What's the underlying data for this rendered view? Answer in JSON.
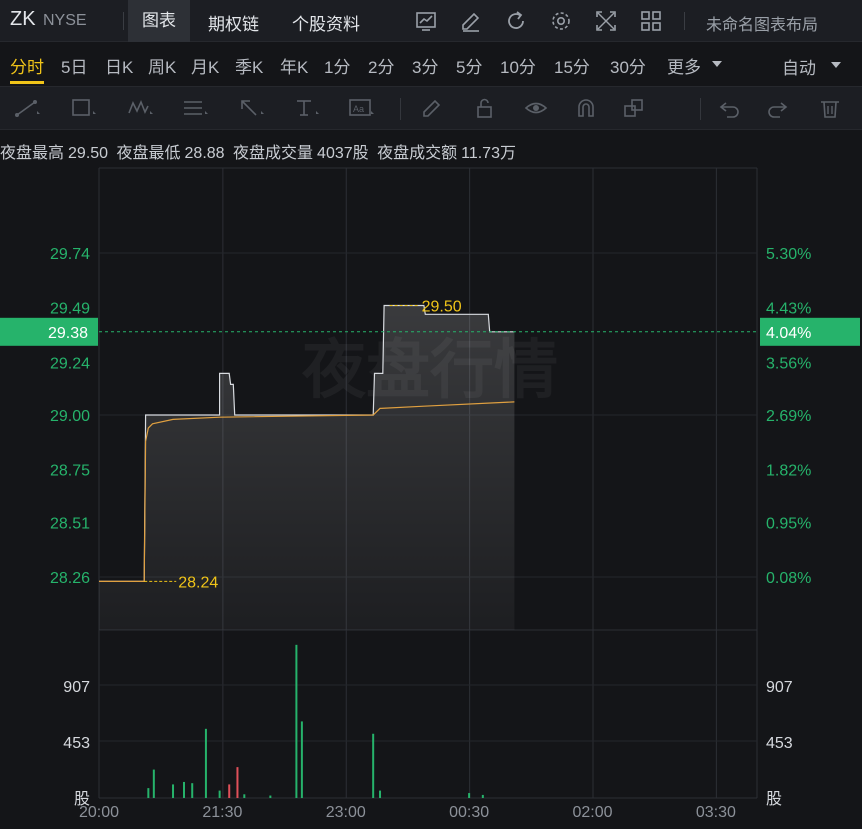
{
  "header": {
    "symbol": "ZK",
    "exchange": "NYSE",
    "tabs": [
      "图表",
      "期权链",
      "个股资料"
    ],
    "layout_label": "未命名图表布局",
    "icons": [
      "trend-chart-icon",
      "edit-icon",
      "refresh-icon",
      "settings-icon",
      "fullscreen-icon",
      "grid-layout-icon"
    ]
  },
  "periods": {
    "items": [
      "分时",
      "5日",
      "日K",
      "周K",
      "月K",
      "季K",
      "年K",
      "1分",
      "2分",
      "3分",
      "5分",
      "10分",
      "15分",
      "30分",
      "更多"
    ],
    "active": "分时",
    "auto_label": "自动"
  },
  "stats": {
    "high_label": "夜盘最高",
    "high_value": "29.50",
    "low_label": "夜盘最低",
    "low_value": "28.88",
    "volume_label": "夜盘成交量",
    "volume_value": "4037股",
    "turnover_label": "夜盘成交额",
    "turnover_value": "11.73万"
  },
  "colors": {
    "up": "#26b36b",
    "accent": "#f0c419",
    "down": "#e0505a",
    "avg_line": "#e0a040",
    "price_line": "#d8dbe0"
  },
  "chart_data": {
    "type": "line",
    "watermark": "夜盘行情",
    "current_price": "29.38",
    "current_pct": "4.04%",
    "high_marker": "29.50",
    "low_marker": "28.24",
    "y_ticks": [
      "29.74",
      "29.49",
      "29.24",
      "29.00",
      "28.75",
      "28.51",
      "28.26"
    ],
    "y_tick_values": [
      29.74,
      29.49,
      29.24,
      29.0,
      28.75,
      28.51,
      28.26
    ],
    "pct_ticks": [
      "5.30%",
      "4.43%",
      "3.56%",
      "2.69%",
      "1.82%",
      "0.95%",
      "0.08%"
    ],
    "x_ticks": [
      "20:00",
      "21:30",
      "23:00",
      "00:30",
      "02:00",
      "03:30"
    ],
    "x_tick_minutes": [
      0,
      90,
      180,
      270,
      360,
      450
    ],
    "x_range_minutes": [
      0,
      480
    ],
    "price_series": [
      [
        0,
        28.24
      ],
      [
        33,
        28.24
      ],
      [
        34,
        29.0
      ],
      [
        54,
        29.0
      ],
      [
        88,
        29.0
      ],
      [
        88,
        29.19
      ],
      [
        95,
        29.19
      ],
      [
        96,
        29.14
      ],
      [
        98,
        29.14
      ],
      [
        99,
        29.0
      ],
      [
        200,
        29.0
      ],
      [
        201,
        29.19
      ],
      [
        207,
        29.19
      ],
      [
        208,
        29.5
      ],
      [
        237,
        29.5
      ],
      [
        238,
        29.46
      ],
      [
        284,
        29.46
      ],
      [
        285,
        29.38
      ],
      [
        303,
        29.38
      ]
    ],
    "avg_series": [
      [
        0,
        28.24
      ],
      [
        33,
        28.24
      ],
      [
        34,
        28.88
      ],
      [
        36,
        28.94
      ],
      [
        39,
        28.96
      ],
      [
        54,
        28.98
      ],
      [
        88,
        28.99
      ],
      [
        200,
        29.0
      ],
      [
        205,
        29.03
      ],
      [
        237,
        29.04
      ],
      [
        303,
        29.06
      ]
    ],
    "volume_ticks": [
      "907",
      "453",
      "股"
    ],
    "volume_tick_values": [
      907,
      453,
      0
    ],
    "volume_bars": [
      {
        "t": 36,
        "v": 80,
        "c": "up"
      },
      {
        "t": 40,
        "v": 230,
        "c": "up"
      },
      {
        "t": 54,
        "v": 110,
        "c": "up"
      },
      {
        "t": 62,
        "v": 130,
        "c": "up"
      },
      {
        "t": 68,
        "v": 120,
        "c": "up"
      },
      {
        "t": 78,
        "v": 560,
        "c": "up"
      },
      {
        "t": 88,
        "v": 60,
        "c": "up"
      },
      {
        "t": 95,
        "v": 110,
        "c": "down"
      },
      {
        "t": 101,
        "v": 250,
        "c": "down"
      },
      {
        "t": 106,
        "v": 30,
        "c": "up"
      },
      {
        "t": 125,
        "v": 20,
        "c": "up"
      },
      {
        "t": 144,
        "v": 1240,
        "c": "up"
      },
      {
        "t": 148,
        "v": 620,
        "c": "up"
      },
      {
        "t": 200,
        "v": 520,
        "c": "up"
      },
      {
        "t": 205,
        "v": 60,
        "c": "up"
      },
      {
        "t": 270,
        "v": 40,
        "c": "up"
      },
      {
        "t": 280,
        "v": 25,
        "c": "up"
      }
    ],
    "volume_max": 1360
  }
}
